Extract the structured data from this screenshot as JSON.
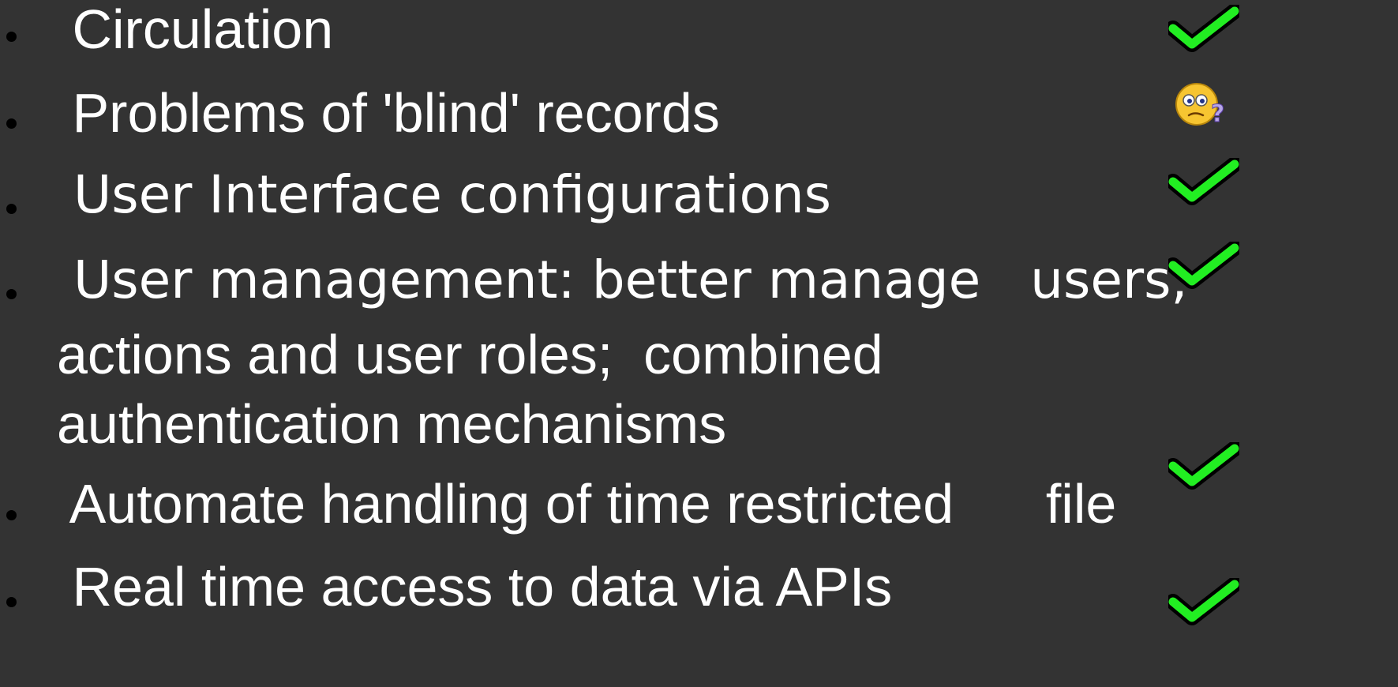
{
  "slide": {
    "items": [
      {
        "lines": [
          " Circulation"
        ],
        "status_icon": "check-icon"
      },
      {
        "lines": [
          " Problems of 'blind' records"
        ],
        "status_icon": "confused-face-icon"
      },
      {
        "lines": [
          " User Interface configurations"
        ],
        "status_icon": "check-icon"
      },
      {
        "lines": [
          " User management: better manage   users,",
          "actions and user roles;  combined",
          "authentication mechanisms"
        ],
        "status_icon": "check-icon"
      },
      {
        "lines": [
          " Automate handling of time restricted      file"
        ],
        "status_icon": "check-icon"
      },
      {
        "lines": [
          " Real time access to data via APIs"
        ],
        "status_icon": "check-icon"
      }
    ]
  },
  "colors": {
    "background": "#333333",
    "text": "#ffffff",
    "bullet": "#000000",
    "check_fill": "#22ee22",
    "check_outline": "#000000",
    "face_fill": "#f7c531"
  }
}
